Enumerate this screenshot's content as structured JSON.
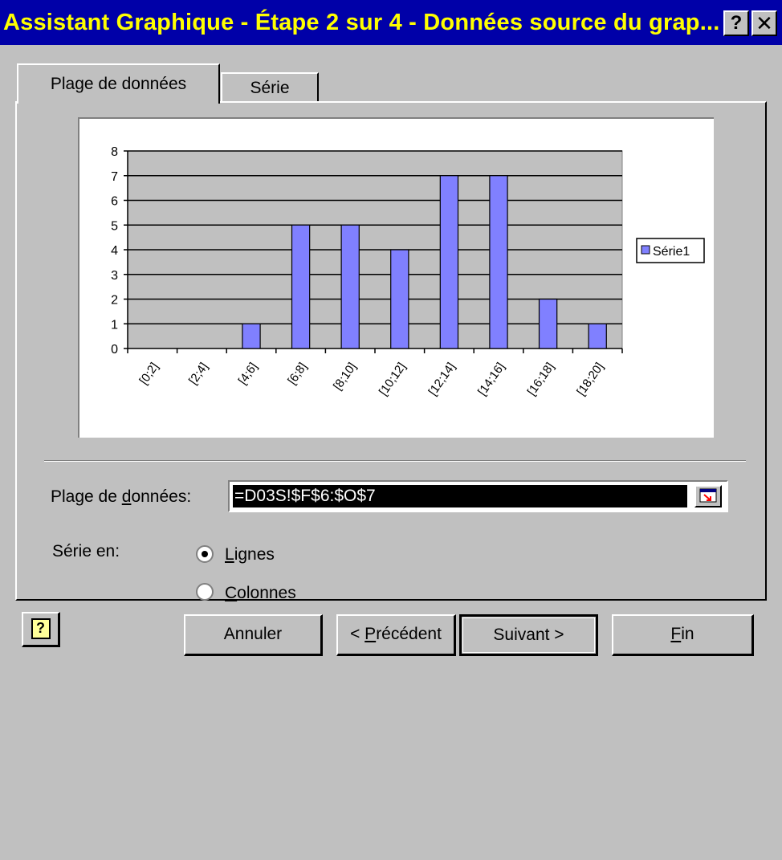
{
  "window": {
    "title": "Assistant Graphique - Étape 2 sur 4 - Données source du grap...",
    "help_glyph": "?",
    "close_glyph": "✕"
  },
  "tabs": [
    {
      "label": "Plage de données",
      "active": true
    },
    {
      "label": "Série",
      "active": false
    }
  ],
  "chart_data": {
    "type": "bar",
    "categories": [
      "[0;2]",
      "[2;4]",
      "[4;6]",
      "[6;8]",
      "[8;10]",
      "[10;12]",
      "[12;14]",
      "[14;16]",
      "[16;18]",
      "[18;20]"
    ],
    "series": [
      {
        "name": "Série1",
        "values": [
          0,
          0,
          1,
          5,
          5,
          4,
          7,
          7,
          2,
          1
        ],
        "color": "#8080ff"
      }
    ],
    "ylim": [
      0,
      8
    ],
    "y_ticks": [
      "0",
      "1",
      "2",
      "3",
      "4",
      "5",
      "6",
      "7",
      "8"
    ],
    "grid": true,
    "plot_background": "#c0c0c0",
    "legend": {
      "position": "right",
      "label": "Série1"
    }
  },
  "data_range": {
    "label_pre": "Plage de ",
    "label_underlined": "d",
    "label_post": "onnées:",
    "value": "=D03S!$F$6:$O$7"
  },
  "series_in": {
    "label": "Série en:",
    "options": [
      {
        "underlined": "L",
        "rest": "ignes",
        "selected": true
      },
      {
        "underlined": "C",
        "rest": "olonnes",
        "selected": false
      }
    ]
  },
  "buttons": {
    "help_glyph": "?",
    "cancel": "Annuler",
    "previous_pre": "< ",
    "previous_underlined": "P",
    "previous_post": "récédent",
    "next": "Suivant >",
    "finish_underlined": "F",
    "finish_post": "in"
  }
}
